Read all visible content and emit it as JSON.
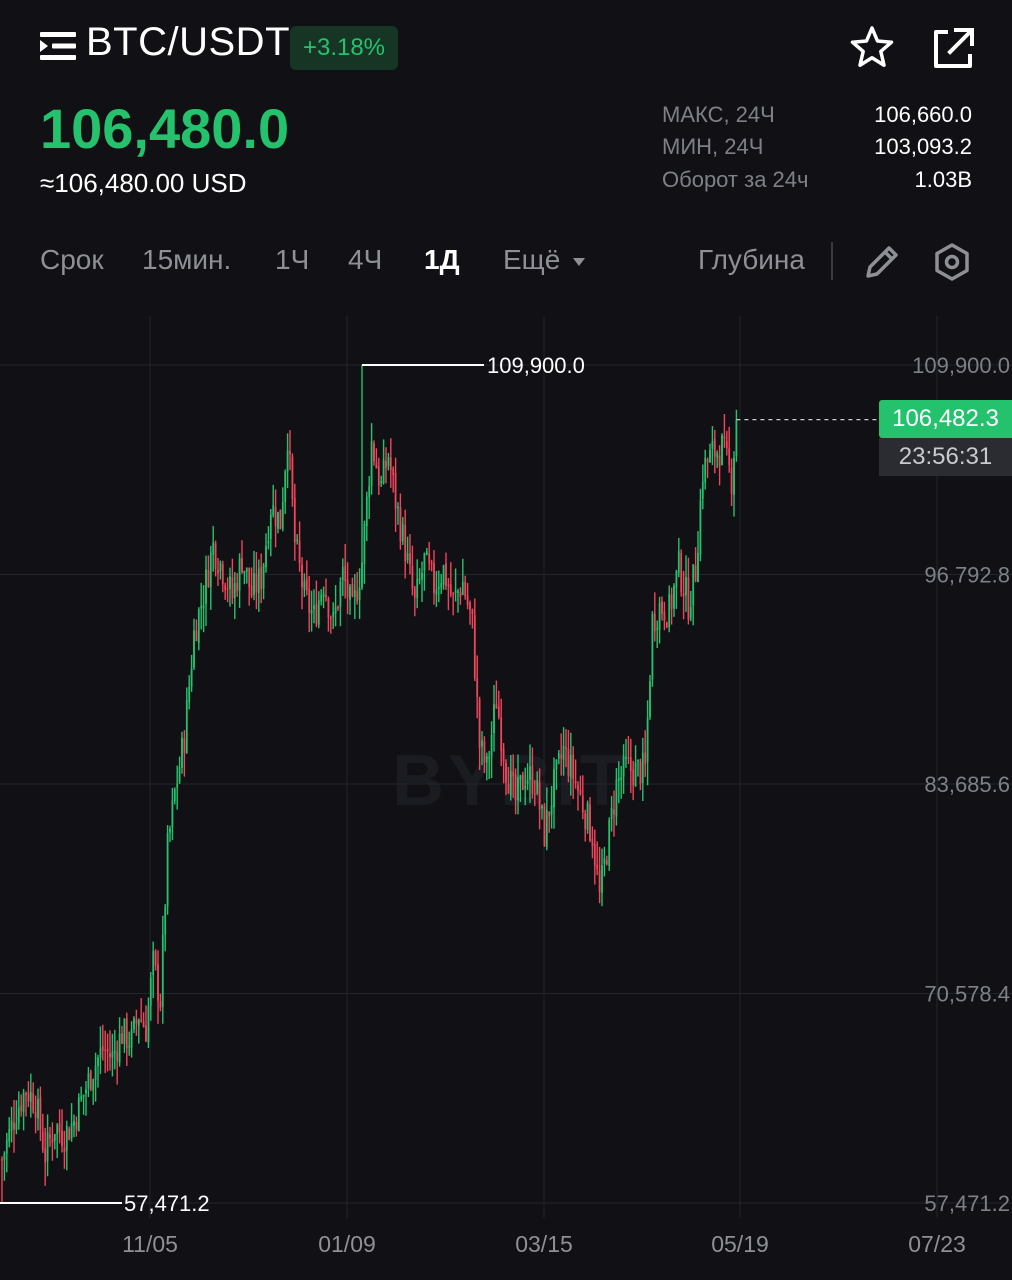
{
  "header": {
    "pair": "BTC/USDT",
    "change": "+3.18%",
    "menu_icon": "list-icon",
    "favorite_icon": "star-icon",
    "share_icon": "share-icon"
  },
  "price": {
    "last": "106,480.0",
    "usd": "≈106,480.00 USD"
  },
  "stats": [
    {
      "label": "МАКС, 24Ч",
      "value": "106,660.0"
    },
    {
      "label": "МИН, 24Ч",
      "value": "103,093.2"
    },
    {
      "label": "Оборот за 24ч",
      "value": "1.03B"
    }
  ],
  "timeframe_tabs": [
    {
      "label": "Срок",
      "active": false
    },
    {
      "label": "15мин.",
      "active": false
    },
    {
      "label": "1Ч",
      "active": false
    },
    {
      "label": "4Ч",
      "active": false
    },
    {
      "label": "1Д",
      "active": true
    },
    {
      "label": "Ещё",
      "active": false
    }
  ],
  "toolbar": {
    "depth_label": "Глубина",
    "draw_icon": "pencil-icon",
    "settings_icon": "settings-hex-icon"
  },
  "colors": {
    "up": "#25c26e",
    "down": "#f0455a",
    "background": "#111115",
    "grid": "#24252b"
  },
  "chart_data": {
    "type": "candlestick",
    "y_ticks": [
      "109,900.0",
      "96,792.8",
      "83,685.6",
      "70,578.4",
      "57,471.2"
    ],
    "x_ticks": [
      "11/05",
      "01/09",
      "03/15",
      "05/19",
      "07/23"
    ],
    "ylim": [
      57471.2,
      109900.0
    ],
    "high_marker": "109,900.0",
    "low_marker": "57,471.2",
    "last_price_tag": "106,482.3",
    "countdown": "23:56:31",
    "watermark": "BYBIT",
    "close_path": [
      [
        0,
        60200
      ],
      [
        6,
        63300
      ],
      [
        10,
        64600
      ],
      [
        14,
        63800
      ],
      [
        18,
        60500
      ],
      [
        22,
        62300
      ],
      [
        26,
        61700
      ],
      [
        30,
        62600
      ],
      [
        34,
        64300
      ],
      [
        38,
        65900
      ],
      [
        42,
        67100
      ],
      [
        46,
        66600
      ],
      [
        50,
        68100
      ],
      [
        54,
        67600
      ],
      [
        57,
        69300
      ],
      [
        60,
        68400
      ],
      [
        63,
        72400
      ],
      [
        66,
        70200
      ],
      [
        69,
        79600
      ],
      [
        72,
        83100
      ],
      [
        76,
        86600
      ],
      [
        80,
        93100
      ],
      [
        84,
        95600
      ],
      [
        88,
        98600
      ],
      [
        92,
        97100
      ],
      [
        96,
        95400
      ],
      [
        100,
        97800
      ],
      [
        104,
        95600
      ],
      [
        108,
        96600
      ],
      [
        112,
        101100
      ],
      [
        116,
        100100
      ],
      [
        119,
        105600
      ],
      [
        122,
        98800
      ],
      [
        126,
        95400
      ],
      [
        130,
        94100
      ],
      [
        134,
        96400
      ],
      [
        138,
        93700
      ],
      [
        142,
        96800
      ],
      [
        146,
        94400
      ],
      [
        150,
        97600
      ],
      [
        154,
        105000
      ],
      [
        158,
        102300
      ],
      [
        161,
        104300
      ],
      [
        164,
        101400
      ],
      [
        168,
        98400
      ],
      [
        172,
        94900
      ],
      [
        176,
        97600
      ],
      [
        180,
        96100
      ],
      [
        184,
        97100
      ],
      [
        188,
        95100
      ],
      [
        192,
        96300
      ],
      [
        196,
        93600
      ],
      [
        199,
        86100
      ],
      [
        202,
        84600
      ],
      [
        206,
        89000
      ],
      [
        210,
        84700
      ],
      [
        214,
        82600
      ],
      [
        218,
        84300
      ],
      [
        222,
        83900
      ],
      [
        226,
        80600
      ],
      [
        230,
        83600
      ],
      [
        234,
        85800
      ],
      [
        238,
        84200
      ],
      [
        242,
        82400
      ],
      [
        246,
        80500
      ],
      [
        249,
        76600
      ],
      [
        252,
        79600
      ],
      [
        256,
        83600
      ],
      [
        260,
        84700
      ],
      [
        264,
        84500
      ],
      [
        268,
        84600
      ],
      [
        271,
        93900
      ],
      [
        274,
        94800
      ],
      [
        278,
        94500
      ],
      [
        282,
        97200
      ],
      [
        286,
        95000
      ],
      [
        289,
        97100
      ],
      [
        292,
        103300
      ],
      [
        296,
        104400
      ],
      [
        300,
        104700
      ],
      [
        304,
        102800
      ],
      [
        306,
        106482.3
      ]
    ]
  }
}
